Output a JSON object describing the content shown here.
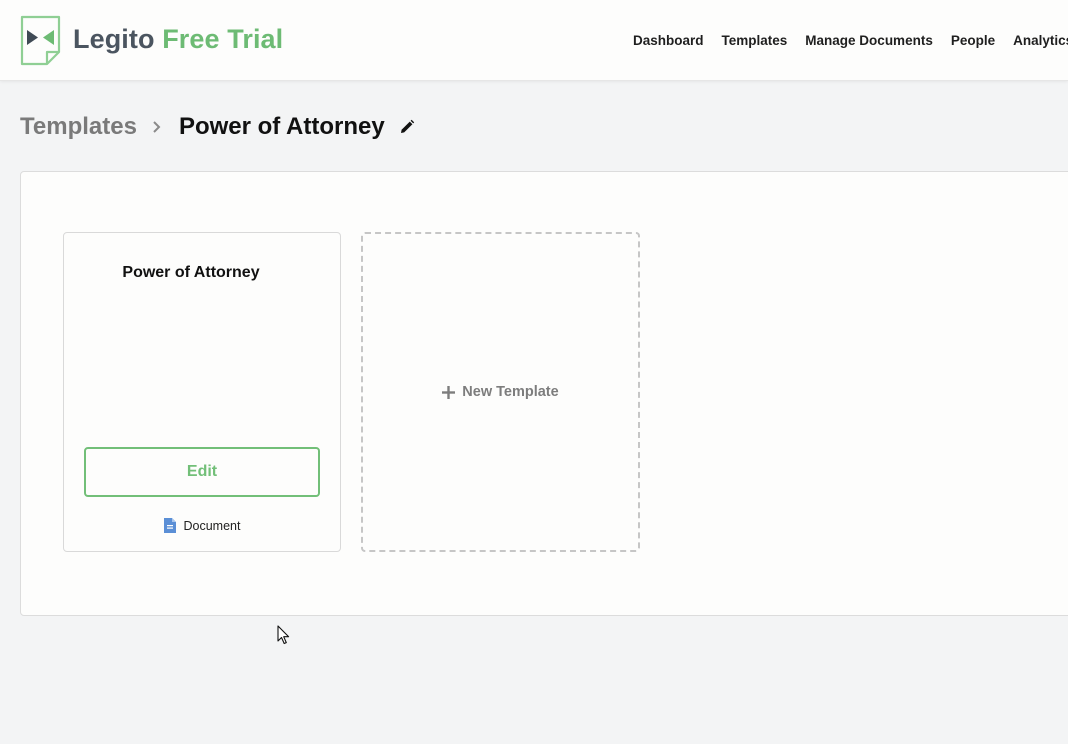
{
  "header": {
    "logo_brand": "Legito",
    "logo_trial": "Free Trial",
    "nav": [
      "Dashboard",
      "Templates",
      "Manage Documents",
      "People",
      "Analytics"
    ]
  },
  "breadcrumb": {
    "parent": "Templates",
    "current": "Power of Attorney"
  },
  "cards": {
    "template": {
      "title": "Power of Attorney",
      "edit_label": "Edit",
      "type_label": "Document"
    },
    "new_template_label": "New Template"
  },
  "colors": {
    "accent_green": "#6dbb74",
    "brand_gray": "#4b5560",
    "doc_icon_blue": "#5b8fd6"
  },
  "icons": {
    "logo": "legito-logo-icon",
    "breadcrumb_sep": "chevron-right-icon",
    "rename": "pencil-icon",
    "doc": "document-icon",
    "add": "plus-icon",
    "pointer": "mouse-cursor-icon"
  }
}
